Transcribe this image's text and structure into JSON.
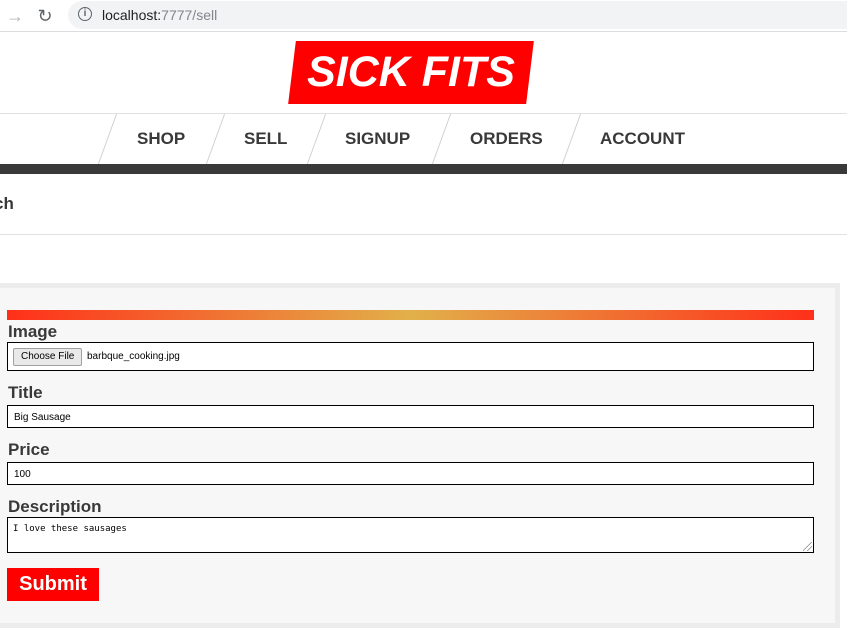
{
  "browser": {
    "url_host": "localhost:",
    "url_path": "7777/sell",
    "back_icon": "arrow-left-icon",
    "reload_icon": "reload-icon",
    "info_icon": "info-icon"
  },
  "header": {
    "logo": "SICK FITS",
    "nav": [
      "SHOP",
      "SELL",
      "SIGNUP",
      "ORDERS",
      "ACCOUNT"
    ]
  },
  "search": {
    "label": "ch"
  },
  "form": {
    "image_label": "Image",
    "file_button": "Choose File",
    "file_name": "barbque_cooking.jpg",
    "title_label": "Title",
    "title_value": "Big Sausage",
    "price_label": "Price",
    "price_value": "100",
    "description_label": "Description",
    "description_value": "I love these sausages",
    "submit_label": "Submit"
  },
  "colors": {
    "brand_red": "#ff0000",
    "text_dark": "#393939",
    "gradient_start": "#ff3019",
    "gradient_mid": "#e2b04a"
  }
}
